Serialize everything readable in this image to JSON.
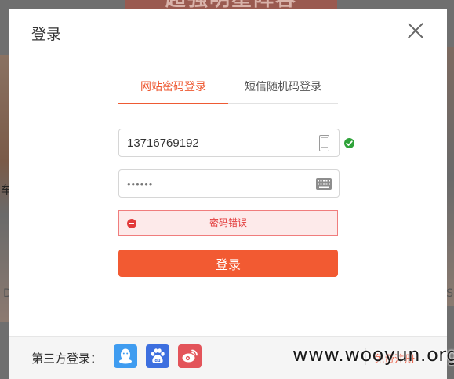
{
  "background": {
    "banner_text": "超强明星阵容",
    "left_char": "车",
    "left_letter": "D",
    "right_letter": "S"
  },
  "dialog": {
    "title": "登录",
    "close_icon": "close-icon"
  },
  "tabs": [
    {
      "label": "网站密码登录",
      "active": true
    },
    {
      "label": "短信随机码登录",
      "active": false
    }
  ],
  "form": {
    "phone_value": "13716769192",
    "password_value": "••••••",
    "error_text": "密码错误",
    "submit_label": "登录"
  },
  "footer": {
    "third_party_label": "第三方登录：",
    "providers": [
      "qq-icon",
      "baidu-icon",
      "weibo-icon"
    ],
    "right_link": "免费注册"
  },
  "watermark": "www.wooyun.org",
  "colors": {
    "accent": "#f25a32",
    "error": "#e23b3b",
    "success": "#2fa33a"
  }
}
